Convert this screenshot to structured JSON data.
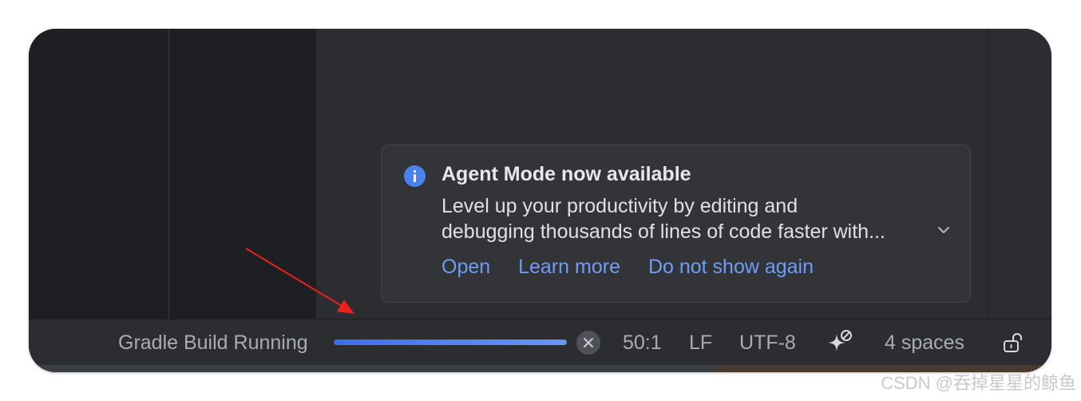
{
  "notification": {
    "title": "Agent Mode now available",
    "body_line1": "Level up your productivity by editing and",
    "body_line2": "debugging thousands of lines of code faster with...",
    "actions": [
      "Open",
      "Learn more",
      "Do not show again"
    ],
    "icon": "info-icon",
    "accent": "#4b82f0"
  },
  "statusbar": {
    "task_label": "Gradle Build Running",
    "progress_percent": 100,
    "position": "50:1",
    "line_separator": "LF",
    "encoding": "UTF-8",
    "ai_icon": "sparkle-icon",
    "indent": "4 spaces",
    "lock_icon": "unlock-icon"
  },
  "watermark": "CSDN @吞掉星星的鲸鱼"
}
